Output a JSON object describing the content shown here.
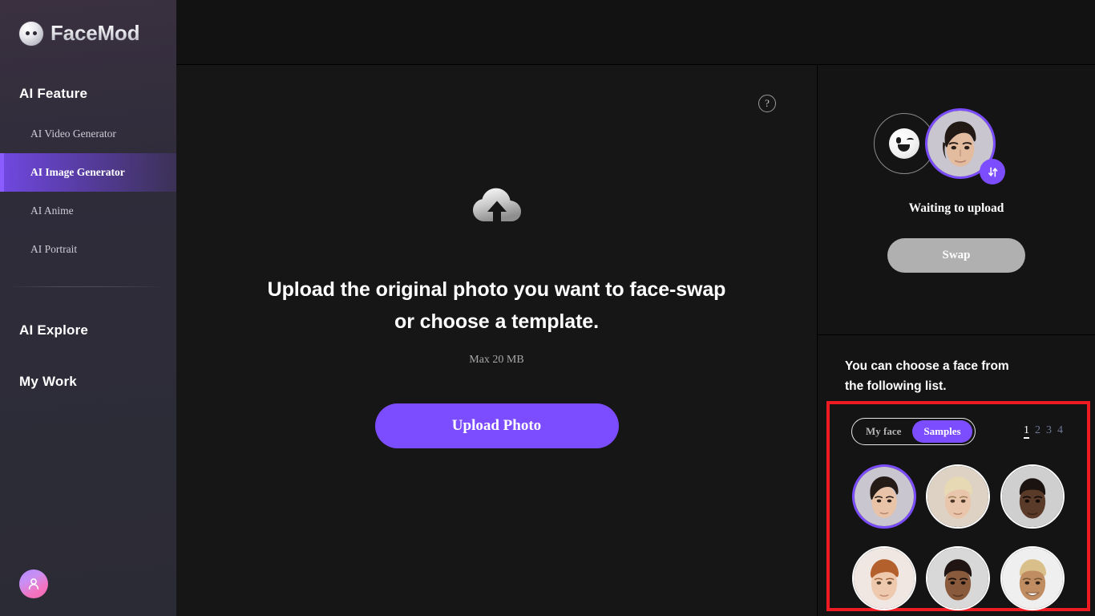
{
  "brand": {
    "name": "FaceMod"
  },
  "sidebar": {
    "section_title": "AI Feature",
    "items": [
      {
        "label": "AI Video Generator",
        "active": false
      },
      {
        "label": "AI Image Generator",
        "active": true
      },
      {
        "label": "AI Anime",
        "active": false
      },
      {
        "label": "AI Portrait",
        "active": false
      }
    ],
    "explore_label": "AI Explore",
    "mywork_label": "My Work"
  },
  "canvas": {
    "help_label": "?",
    "title": "Upload the original photo you want to face-swap or choose a template.",
    "subtitle": "Max 20 MB",
    "upload_button": "Upload Photo"
  },
  "right_panel": {
    "status": "Waiting to upload",
    "swap_button": "Swap",
    "choose_text": "You can choose a face from the following list.",
    "segments": [
      {
        "label": "My face",
        "active": false
      },
      {
        "label": "Samples",
        "active": true
      }
    ],
    "pages": [
      {
        "label": "1",
        "active": true
      },
      {
        "label": "2",
        "active": false
      },
      {
        "label": "3",
        "active": false
      },
      {
        "label": "4",
        "active": false
      }
    ],
    "faces": [
      {
        "id": "face-1",
        "selected": true,
        "skin": "#e8c3a8",
        "hair": "#241a16",
        "bg": "#c9c6cf"
      },
      {
        "id": "face-2",
        "selected": false,
        "skin": "#e9c6ab",
        "hair": "#e6d9b4",
        "bg": "#ddd2c4"
      },
      {
        "id": "face-3",
        "selected": false,
        "skin": "#5a3a28",
        "hair": "#1b1310",
        "bg": "#cfcfcf"
      },
      {
        "id": "face-4",
        "selected": false,
        "skin": "#eec9ae",
        "hair": "#b4602d",
        "bg": "#f0e7e2"
      },
      {
        "id": "face-5",
        "selected": false,
        "skin": "#8a5a3c",
        "hair": "#201512",
        "bg": "#d8d8d8"
      },
      {
        "id": "face-6",
        "selected": false,
        "skin": "#c08d62",
        "hair": "#d9c08a",
        "bg": "#efefef"
      }
    ],
    "selected_preview": {
      "skin": "#e3bb9f",
      "hair": "#221915",
      "bg": "#cac6cf"
    }
  },
  "colors": {
    "accent_purple": "#7c4dff",
    "annotation_red": "#ef1b23",
    "disabled_gray": "#b0b0b0",
    "sidebar_bg": "#2f2c3a",
    "canvas_bg": "#161616"
  }
}
